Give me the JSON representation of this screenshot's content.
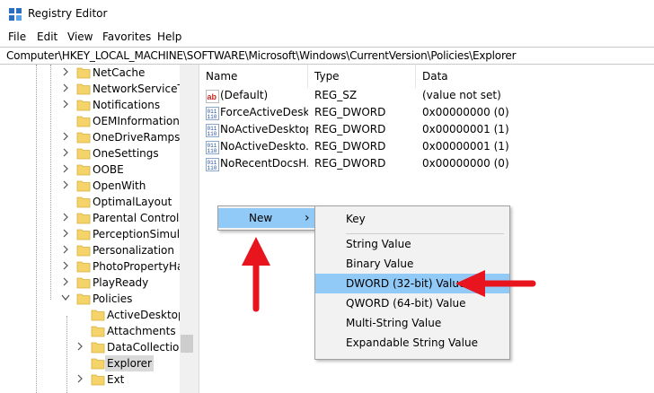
{
  "window": {
    "title": "Registry Editor"
  },
  "menu": [
    "File",
    "Edit",
    "View",
    "Favorites",
    "Help"
  ],
  "address": "Computer\\HKEY_LOCAL_MACHINE\\SOFTWARE\\Microsoft\\Windows\\CurrentVersion\\Policies\\Explorer",
  "tree": [
    {
      "label": "NetCache",
      "level": 1,
      "expandable": true
    },
    {
      "label": "NetworkServiceTrig",
      "level": 1,
      "expandable": true
    },
    {
      "label": "Notifications",
      "level": 1,
      "expandable": true
    },
    {
      "label": "OEMInformation",
      "level": 1,
      "expandable": false
    },
    {
      "label": "OneDriveRamps",
      "level": 1,
      "expandable": true
    },
    {
      "label": "OneSettings",
      "level": 1,
      "expandable": true
    },
    {
      "label": "OOBE",
      "level": 1,
      "expandable": true
    },
    {
      "label": "OpenWith",
      "level": 1,
      "expandable": true
    },
    {
      "label": "OptimalLayout",
      "level": 1,
      "expandable": false
    },
    {
      "label": "Parental Controls",
      "level": 1,
      "expandable": true
    },
    {
      "label": "PerceptionSimulat",
      "level": 1,
      "expandable": true
    },
    {
      "label": "Personalization",
      "level": 1,
      "expandable": true
    },
    {
      "label": "PhotoPropertyHar",
      "level": 1,
      "expandable": true
    },
    {
      "label": "PlayReady",
      "level": 1,
      "expandable": true
    },
    {
      "label": "Policies",
      "level": 1,
      "expandable": true,
      "expanded": true
    },
    {
      "label": "ActiveDesktop",
      "level": 2,
      "expandable": false
    },
    {
      "label": "Attachments",
      "level": 2,
      "expandable": false
    },
    {
      "label": "DataCollection",
      "level": 2,
      "expandable": true
    },
    {
      "label": "Explorer",
      "level": 2,
      "expandable": false,
      "selected": true
    },
    {
      "label": "Ext",
      "level": 2,
      "expandable": true
    }
  ],
  "columns": {
    "name": "Name",
    "type": "Type",
    "data": "Data"
  },
  "values": [
    {
      "name": "(Default)",
      "type": "REG_SZ",
      "data": "(value not set)",
      "icon": "string-value-icon"
    },
    {
      "name": "ForceActiveDesk...",
      "type": "REG_DWORD",
      "data": "0x00000000 (0)",
      "icon": "binary-value-icon"
    },
    {
      "name": "NoActiveDesktop",
      "type": "REG_DWORD",
      "data": "0x00000001 (1)",
      "icon": "binary-value-icon"
    },
    {
      "name": "NoActiveDeskto...",
      "type": "REG_DWORD",
      "data": "0x00000001 (1)",
      "icon": "binary-value-icon"
    },
    {
      "name": "NoRecentDocsH...",
      "type": "REG_DWORD",
      "data": "0x00000000 (0)",
      "icon": "binary-value-icon"
    }
  ],
  "context_menu": {
    "new_label": "New",
    "arrow": "›"
  },
  "submenu": {
    "key": "Key",
    "items": [
      "String Value",
      "Binary Value",
      "DWORD (32-bit) Value",
      "QWORD (64-bit) Value",
      "Multi-String Value",
      "Expandable String Value"
    ],
    "highlighted": "DWORD (32-bit) Value"
  },
  "colors": {
    "annotation_red": "#e8141e",
    "highlight": "#91c9f7",
    "folder": "#f4d36a"
  }
}
